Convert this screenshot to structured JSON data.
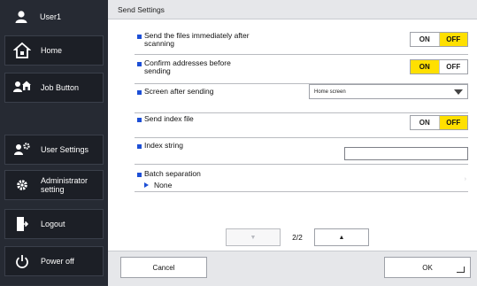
{
  "sidebar": {
    "user": "User1",
    "items": [
      {
        "label": "Home",
        "icon": "home-icon"
      },
      {
        "label": "Job Button",
        "icon": "job-button-icon"
      },
      {
        "label": "User Settings",
        "icon": "user-settings-icon"
      },
      {
        "label": "Administrator setting",
        "icon": "admin-gear-icon"
      },
      {
        "label": "Logout",
        "icon": "logout-icon"
      },
      {
        "label": "Power off",
        "icon": "power-icon"
      }
    ]
  },
  "main": {
    "title": "Send Settings",
    "rows": {
      "send_immediately": {
        "label": "Send the files immediately after scanning",
        "on": "ON",
        "off": "OFF",
        "selected": "OFF"
      },
      "confirm_addresses": {
        "label": "Confirm addresses before sending",
        "on": "ON",
        "off": "OFF",
        "selected": "ON"
      },
      "screen_after": {
        "label": "Screen after sending",
        "value": "Home screen"
      },
      "index_file": {
        "label": "Send index file",
        "on": "ON",
        "off": "OFF",
        "selected": "OFF"
      },
      "index_string": {
        "label": "Index string",
        "value": ""
      },
      "batch": {
        "label": "Batch separation",
        "sub": "None"
      }
    },
    "pager": {
      "current": "2/2"
    }
  },
  "footer": {
    "cancel": "Cancel",
    "ok": "OK"
  },
  "colors": {
    "accent_blue": "#1d4fd6",
    "toggle_selected": "#ffe000",
    "sidebar_bg": "#262a33"
  }
}
